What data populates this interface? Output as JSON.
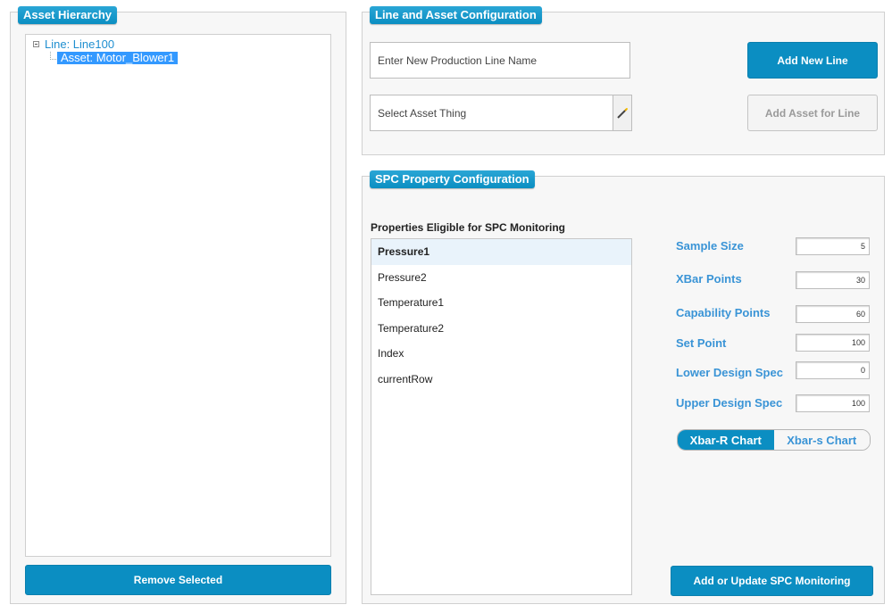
{
  "asset_hierarchy": {
    "title": "Asset Hierarchy",
    "tree": {
      "root_label": "Line: Line100",
      "child_label": "Asset: Motor_Blower1"
    },
    "remove_button": "Remove Selected"
  },
  "line_config": {
    "title": "Line and Asset Configuration",
    "line_name_placeholder": "Enter New Production Line Name",
    "add_line_button": "Add New Line",
    "asset_thing_placeholder": "Select Asset Thing",
    "add_asset_button": "Add Asset for Line"
  },
  "spc_config": {
    "title": "SPC Property Configuration",
    "properties_heading": "Properties Eligible for SPC Monitoring",
    "properties": [
      "Pressure1",
      "Pressure2",
      "Temperature1",
      "Temperature2",
      "Index",
      "currentRow"
    ],
    "selected_property": "Pressure1",
    "fields": {
      "sample_size": {
        "label": "Sample Size",
        "value": "5"
      },
      "xbar_points": {
        "label": "XBar Points",
        "value": "30"
      },
      "capability_points": {
        "label": "Capability Points",
        "value": "60"
      },
      "set_point": {
        "label": "Set Point",
        "value": "100"
      },
      "lower_design_spec": {
        "label": "Lower Design Spec",
        "value": "0"
      },
      "upper_design_spec": {
        "label": "Upper Design Spec",
        "value": "100"
      }
    },
    "chart_toggle": {
      "options": [
        "Xbar-R Chart",
        "Xbar-s Chart"
      ],
      "selected": "Xbar-R Chart"
    },
    "submit_button": "Add or Update SPC Monitoring"
  },
  "colors": {
    "accent": "#0b8ec2",
    "label_blue": "#3a94d6",
    "tree_selection": "#3399ff"
  },
  "icons": {
    "tree_expander": "minus-box-icon",
    "asset_picker": "magic-wand-icon"
  }
}
